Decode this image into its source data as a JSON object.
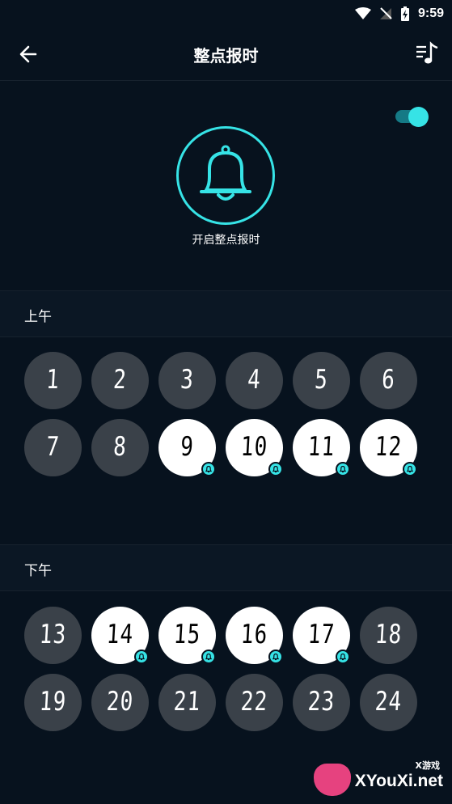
{
  "status_bar": {
    "time": "9:59"
  },
  "app_bar": {
    "title": "整点报时"
  },
  "toggle": {
    "on": true
  },
  "hero": {
    "label": "开启整点报时"
  },
  "sections": {
    "am": {
      "label": "上午"
    },
    "pm": {
      "label": "下午"
    }
  },
  "am_hours": [
    {
      "n": "1",
      "on": false
    },
    {
      "n": "2",
      "on": false
    },
    {
      "n": "3",
      "on": false
    },
    {
      "n": "4",
      "on": false
    },
    {
      "n": "5",
      "on": false
    },
    {
      "n": "6",
      "on": false
    },
    {
      "n": "7",
      "on": false
    },
    {
      "n": "8",
      "on": false
    },
    {
      "n": "9",
      "on": true
    },
    {
      "n": "10",
      "on": true
    },
    {
      "n": "11",
      "on": true
    },
    {
      "n": "12",
      "on": true
    }
  ],
  "pm_hours": [
    {
      "n": "13",
      "on": false
    },
    {
      "n": "14",
      "on": true
    },
    {
      "n": "15",
      "on": true
    },
    {
      "n": "16",
      "on": true
    },
    {
      "n": "17",
      "on": true
    },
    {
      "n": "18",
      "on": false
    },
    {
      "n": "19",
      "on": false
    },
    {
      "n": "20",
      "on": false
    },
    {
      "n": "21",
      "on": false
    },
    {
      "n": "22",
      "on": false
    },
    {
      "n": "23",
      "on": false
    },
    {
      "n": "24",
      "on": false
    }
  ],
  "colors": {
    "accent": "#36e3e6",
    "background": "#07121e",
    "hour_off": "#3a4149",
    "hour_on": "#ffffff"
  },
  "watermark": {
    "cn": "X游戏",
    "text": "XYouXi.net"
  }
}
